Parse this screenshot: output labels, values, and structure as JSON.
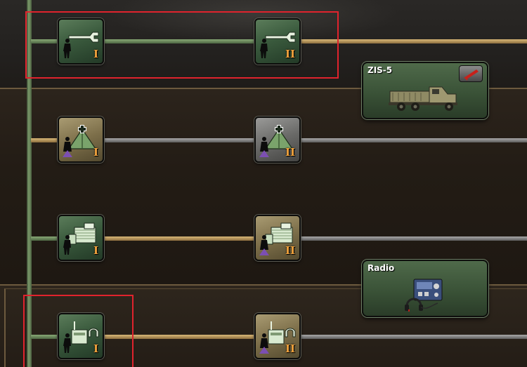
{
  "tech_tree": {
    "rows": [
      {
        "tiles": [
          {
            "icon": "wrench-icon",
            "level": "I",
            "style": "green"
          },
          {
            "icon": "wrench-icon",
            "level": "II",
            "style": "green"
          }
        ]
      },
      {
        "tiles": [
          {
            "icon": "field-hospital-tent-icon",
            "level": "I",
            "style": "tan"
          },
          {
            "icon": "field-hospital-tent-icon",
            "level": "II",
            "style": "gray"
          }
        ]
      },
      {
        "tiles": [
          {
            "icon": "supply-depot-icon",
            "level": "I",
            "style": "green"
          },
          {
            "icon": "supply-depot-icon",
            "level": "II",
            "style": "tan"
          }
        ]
      },
      {
        "tiles": [
          {
            "icon": "radio-signal-icon",
            "level": "I",
            "style": "green"
          },
          {
            "icon": "radio-signal-icon",
            "level": "II",
            "style": "tan"
          }
        ]
      }
    ],
    "cards": [
      {
        "title": "ZIS-5",
        "image": "truck-icon",
        "has_button": true
      },
      {
        "title": "Radio",
        "image": "radio-set-icon",
        "has_button": false
      }
    ]
  },
  "colors": {
    "highlight": "#e0232d",
    "level_text": "#f0a23c",
    "line_green": "#7b9a6a",
    "line_gold": "#c9a463",
    "line_gray": "#9a9a9a"
  }
}
